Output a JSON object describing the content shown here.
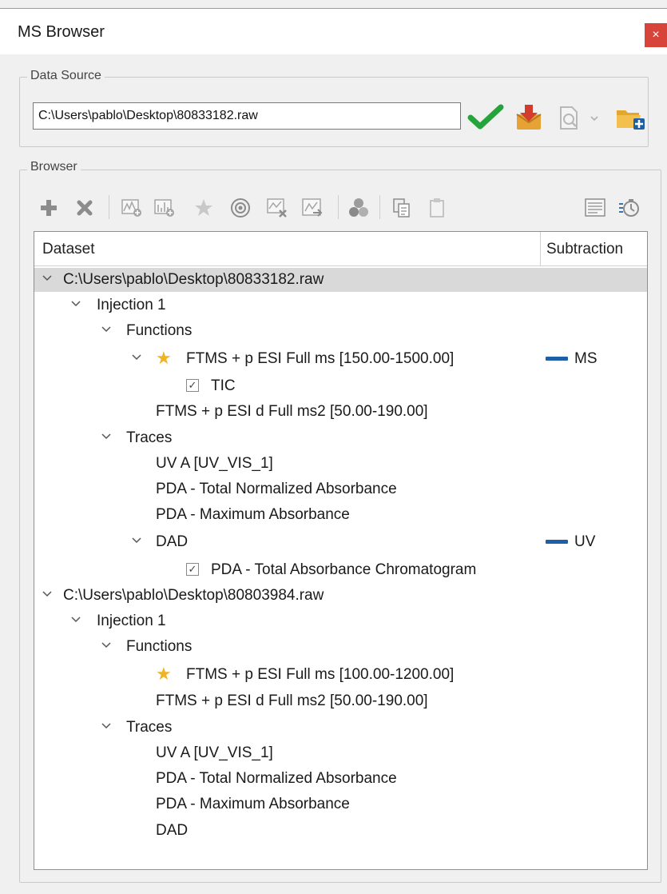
{
  "window": {
    "title": "MS Browser",
    "close_glyph": "×"
  },
  "data_source": {
    "legend": "Data Source",
    "path_value": "C:\\Users\\pablo\\Desktop\\80833182.raw",
    "icons": [
      "check-icon",
      "download-icon",
      "document-search-icon",
      "dropdown-arrow-icon",
      "add-folder-icon"
    ]
  },
  "browser": {
    "legend": "Browser",
    "toolbar_icons": [
      "add-icon",
      "remove-icon",
      "add-chromatogram-icon",
      "add-spectrum-icon",
      "star-icon",
      "target-icon",
      "remove-trace-icon",
      "export-trace-icon",
      "color-icon",
      "copy-icon",
      "paste-icon",
      "settings-list-icon",
      "time-icon"
    ],
    "columns": {
      "dataset": "Dataset",
      "subtraction": "Subtraction"
    },
    "rows": [
      {
        "label": "C:\\Users\\pablo\\Desktop\\80833182.raw",
        "subtraction": ""
      },
      {
        "label": "Injection 1",
        "subtraction": ""
      },
      {
        "label": "Functions",
        "subtraction": ""
      },
      {
        "label": "FTMS + p ESI Full ms [150.00-1500.00]",
        "subtraction": "MS"
      },
      {
        "label": "TIC",
        "subtraction": "",
        "checked": true
      },
      {
        "label": "FTMS + p ESI d Full ms2 [50.00-190.00]",
        "subtraction": ""
      },
      {
        "label": "Traces",
        "subtraction": ""
      },
      {
        "label": "UV A [UV_VIS_1]",
        "subtraction": ""
      },
      {
        "label": "PDA - Total Normalized Absorbance",
        "subtraction": ""
      },
      {
        "label": "PDA - Maximum Absorbance",
        "subtraction": ""
      },
      {
        "label": "DAD",
        "subtraction": "UV"
      },
      {
        "label": "PDA - Total Absorbance Chromatogram",
        "subtraction": "",
        "checked": true
      },
      {
        "label": "C:\\Users\\pablo\\Desktop\\80803984.raw",
        "subtraction": ""
      },
      {
        "label": "Injection 1",
        "subtraction": ""
      },
      {
        "label": "Functions",
        "subtraction": ""
      },
      {
        "label": "FTMS + p ESI Full ms [100.00-1200.00]",
        "subtraction": ""
      },
      {
        "label": "FTMS + p ESI d Full ms2 [50.00-190.00]",
        "subtraction": ""
      },
      {
        "label": "Traces",
        "subtraction": ""
      },
      {
        "label": "UV A [UV_VIS_1]",
        "subtraction": ""
      },
      {
        "label": "PDA - Total Normalized Absorbance",
        "subtraction": ""
      },
      {
        "label": "PDA - Maximum Absorbance",
        "subtraction": ""
      },
      {
        "label": "DAD",
        "subtraction": ""
      }
    ]
  },
  "colors": {
    "accent_blue": "#1f5fa8",
    "check_green": "#27a33c",
    "star_gold": "#f0b323",
    "close_red": "#d7443a",
    "selection_gray": "#d9d9d9"
  }
}
